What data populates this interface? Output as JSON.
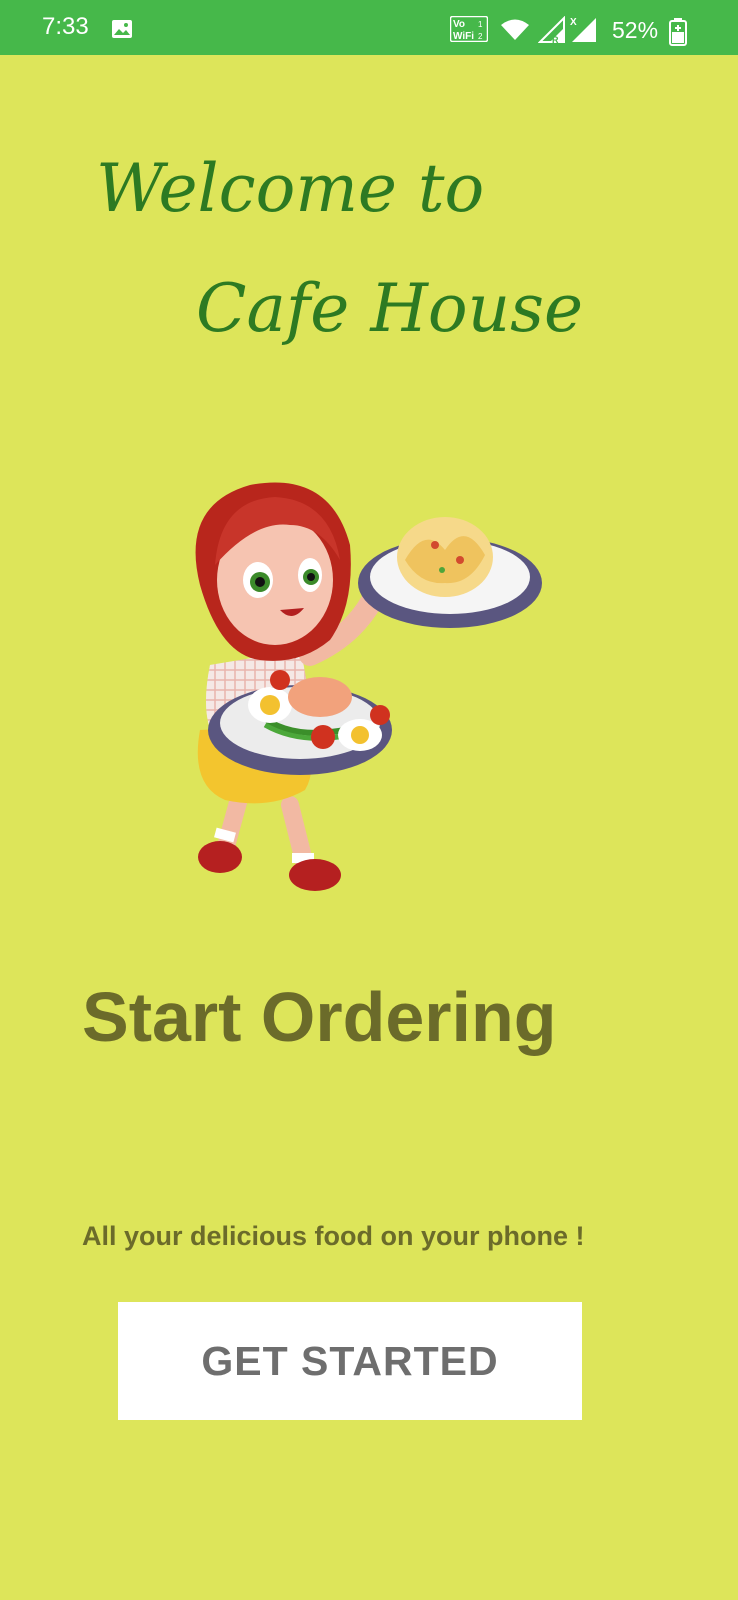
{
  "status_bar": {
    "time": "7:33",
    "battery_percent": "52%",
    "network_badge": "Vo WiFi 2",
    "signal_badges": [
      "R",
      "X"
    ]
  },
  "welcome": {
    "line1": "Welcome to",
    "line2": "Cafe House"
  },
  "hero": {
    "title": "Start Ordering",
    "tagline": "All your delicious food on your phone !"
  },
  "cta": {
    "label": "GET STARTED"
  },
  "colors": {
    "background": "#dde55a",
    "status_bar": "#46b84a",
    "welcome_text": "#2d7a22",
    "hero_text": "#6b6b2a",
    "button_bg": "#ffffff",
    "button_text": "#6e6e6e"
  },
  "icons": [
    "gallery-icon",
    "volte-wifi-icon",
    "wifi-icon",
    "signal-icon",
    "battery-icon",
    "waitress-illustration"
  ]
}
